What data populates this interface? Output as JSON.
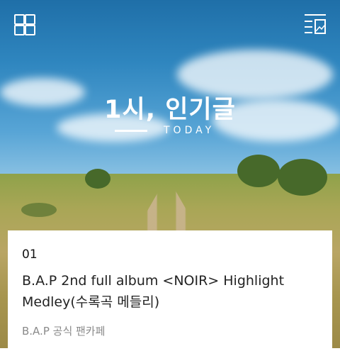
{
  "header": {
    "menu_icon": "grid-icon",
    "view_icon": "list-icon"
  },
  "banner": {
    "title": "1시, 인기글",
    "subtitle": "TODAY"
  },
  "post": {
    "rank": "01",
    "title": "B.A.P 2nd full album <NOIR> Highlight Medley(수록곡 메들리)",
    "source": "B.A.P 공식 팬카페"
  },
  "colors": {
    "sky": "#2f86bf",
    "text_primary": "#222222",
    "text_secondary": "#8a8a8a"
  }
}
